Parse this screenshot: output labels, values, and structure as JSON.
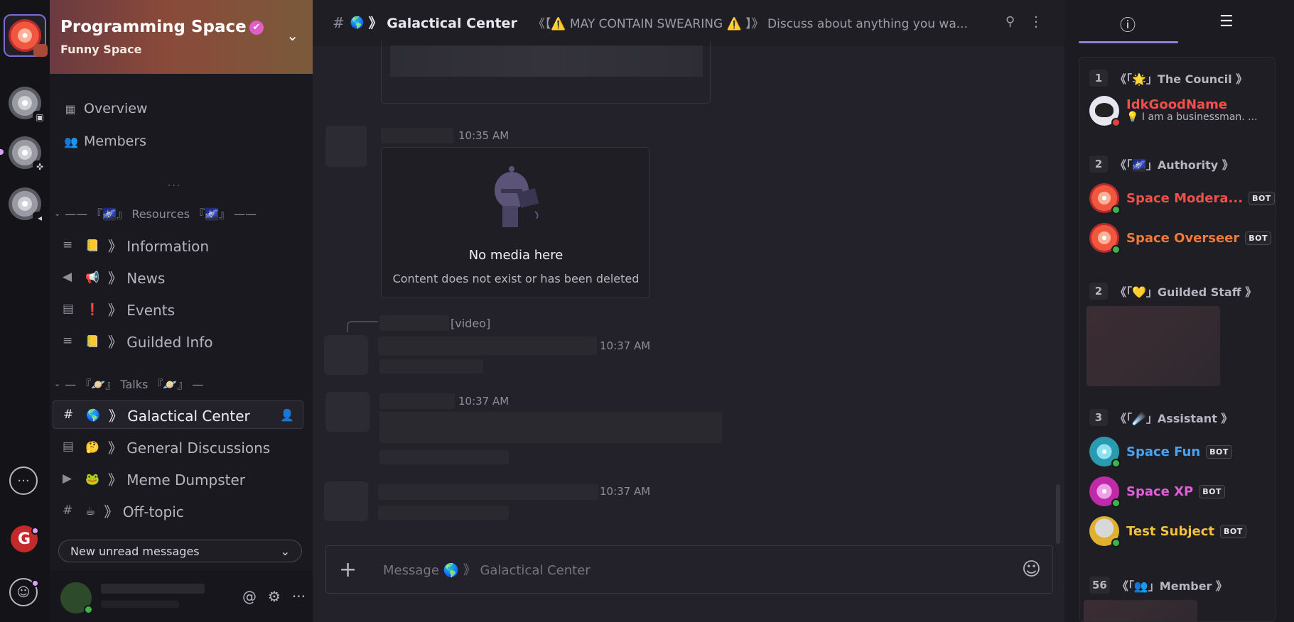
{
  "server": {
    "name": "Programming Space",
    "subtitle": "Funny Space",
    "verified_icon": "✔",
    "chevron": "⌄"
  },
  "sidebar": {
    "nav": [
      {
        "label": "Overview",
        "icon": "overview-icon",
        "glyph": "▦"
      },
      {
        "label": "Members",
        "icon": "members-icon",
        "glyph": "👥"
      }
    ],
    "ellipsis": "...",
    "categories": [
      {
        "label": "—— 『🌌』 Resources 『🌌』 ——"
      },
      {
        "label": "— 『🪐』 Talks 『🪐』 —"
      }
    ],
    "channels": [
      {
        "icon": "doc-icon",
        "glyph": "≡",
        "emoji": "📒",
        "label": "》 Information"
      },
      {
        "icon": "megaphone-icon",
        "glyph": "📢",
        "emoji": "📢",
        "label": "》 News"
      },
      {
        "icon": "calendar-icon",
        "glyph": "▤",
        "emoji": "❗",
        "label": "》 Events"
      },
      {
        "icon": "doc-icon",
        "glyph": "≡",
        "emoji": "📒",
        "label": "》 Guilded Info"
      },
      {
        "icon": "hash-icon",
        "glyph": "#",
        "emoji": "🌎",
        "label": "》 Galactical Center",
        "selected": true
      },
      {
        "icon": "forum-icon",
        "glyph": "▤",
        "emoji": "🤔",
        "label": "》 General Discussions"
      },
      {
        "icon": "media-icon",
        "glyph": "▶",
        "emoji": "🐸",
        "label": "》 Meme Dumpster"
      },
      {
        "icon": "hash-icon",
        "glyph": "#",
        "emoji": "☕",
        "label": "》 Off-topic"
      }
    ],
    "unread_label": "New unread messages",
    "user_actions": {
      "mention": "@",
      "settings": "⚙",
      "more": "···"
    }
  },
  "channel": {
    "hash": "#",
    "emoji": "🌎",
    "name": "》 Galactical Center",
    "topic": "《【⚠️ MAY CONTAIN SWEARING ⚠️ 】》 Discuss about anything you wa...",
    "pin": "📌",
    "more": "⋮"
  },
  "messages": {
    "times": [
      "10:35 AM",
      "10:37 AM",
      "10:37 AM",
      "10:37 AM"
    ],
    "media_title": "No media here",
    "media_sub": "Content does not exist or has been deleted",
    "video_tag": "[video]"
  },
  "composer": {
    "plus": "+",
    "placeholder": "Message 🌎 》 Galactical Center",
    "emoji_button": "☺"
  },
  "right_panel": {
    "tab_info": "ⓘ",
    "tab_list": "☰",
    "groups": [
      {
        "count": "1",
        "label": "《「🌟」The Council 》"
      },
      {
        "count": "2",
        "label": "《「🌌」Authority 》"
      },
      {
        "count": "2",
        "label": "《「💛」Guilded Staff 》"
      },
      {
        "count": "3",
        "label": "《「☄️」Assistant 》"
      },
      {
        "count": "56",
        "label": "《「👥」Member 》"
      }
    ],
    "members": [
      {
        "name": "IdkGoodName",
        "color": "#f0504a",
        "status": "💡 I am a businessman. ..."
      },
      {
        "name": "Space Modera...",
        "color": "#f0504a",
        "bot": "BOT"
      },
      {
        "name": "Space Overseer",
        "color": "#f07a3a",
        "bot": "BOT"
      },
      {
        "name": "Space Fun",
        "color": "#4aa3f0",
        "bot": "BOT"
      },
      {
        "name": "Space XP",
        "color": "#e05fd6",
        "bot": "BOT"
      },
      {
        "name": "Test Subject",
        "color": "#f0c23a",
        "bot": "BOT"
      }
    ]
  },
  "colors": {
    "accent": "#8d84d6",
    "online": "#3bb54a",
    "notification": "#d9a0ff"
  }
}
